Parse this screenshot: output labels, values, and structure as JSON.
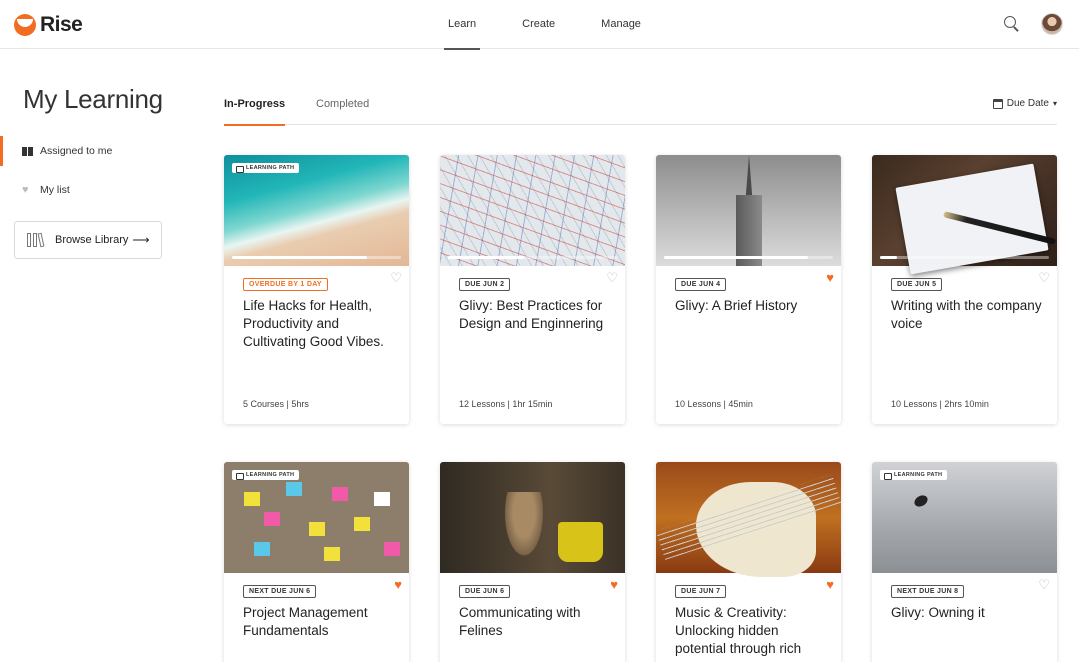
{
  "app": {
    "name": "Rise",
    "brand_color": "#f26d21"
  },
  "nav": {
    "items": [
      "Learn",
      "Create",
      "Manage"
    ],
    "active": "Learn"
  },
  "header_icons": [
    "search-icon",
    "avatar"
  ],
  "sidebar": {
    "title": "My Learning",
    "items": [
      {
        "label": "Assigned to me",
        "icon": "book-icon",
        "active": true
      },
      {
        "label": "My list",
        "icon": "heart-icon",
        "active": false
      }
    ],
    "browse": {
      "label": "Browse Library",
      "icon": "library-icon",
      "arrow": "⟶"
    }
  },
  "tabs": {
    "items": [
      "In-Progress",
      "Completed"
    ],
    "active": "In-Progress"
  },
  "sort": {
    "label": "Due Date",
    "icon": "calendar-icon"
  },
  "cards": [
    {
      "tag": "LEARNING PATH",
      "badge": "OVERDUE BY 1 DAY",
      "overdue": true,
      "favorite": false,
      "title": "Life Hacks for Health, Productivity and Cultivating Good Vibes.",
      "meta": "5 Courses | 5hrs",
      "progress": 0.8
    },
    {
      "tag": "",
      "badge": "DUE JUN 2",
      "overdue": false,
      "favorite": false,
      "title": "Glivy: Best Practices for Design and Enginnering",
      "meta": "12 Lessons  |  1hr 15min",
      "progress": 0.45
    },
    {
      "tag": "",
      "badge": "DUE JUN 4",
      "overdue": false,
      "favorite": true,
      "title": "Glivy: A Brief History",
      "meta": "10 Lessons  |  45min",
      "progress": 0.85
    },
    {
      "tag": "",
      "badge": "DUE JUN 5",
      "overdue": false,
      "favorite": false,
      "title": "Writing with the company voice",
      "meta": "10 Lessons  |  2hrs 10min",
      "progress": 0.1
    },
    {
      "tag": "LEARNING PATH",
      "badge": "NEXT DUE JUN 6",
      "overdue": false,
      "favorite": true,
      "title": "Project Management Fundamentals",
      "meta": "",
      "progress": null
    },
    {
      "tag": "",
      "badge": "DUE JUN 6",
      "overdue": false,
      "favorite": true,
      "title": "Communicating with Felines",
      "meta": "",
      "progress": null
    },
    {
      "tag": "",
      "badge": "DUE JUN 7",
      "overdue": false,
      "favorite": true,
      "title": "Music & Creativity: Unlocking hidden potential through rich",
      "meta": "",
      "progress": null
    },
    {
      "tag": "LEARNING PATH",
      "badge": "NEXT DUE JUN 8",
      "overdue": false,
      "favorite": false,
      "title": "Glivy: Owning it",
      "meta": "",
      "progress": null
    }
  ]
}
